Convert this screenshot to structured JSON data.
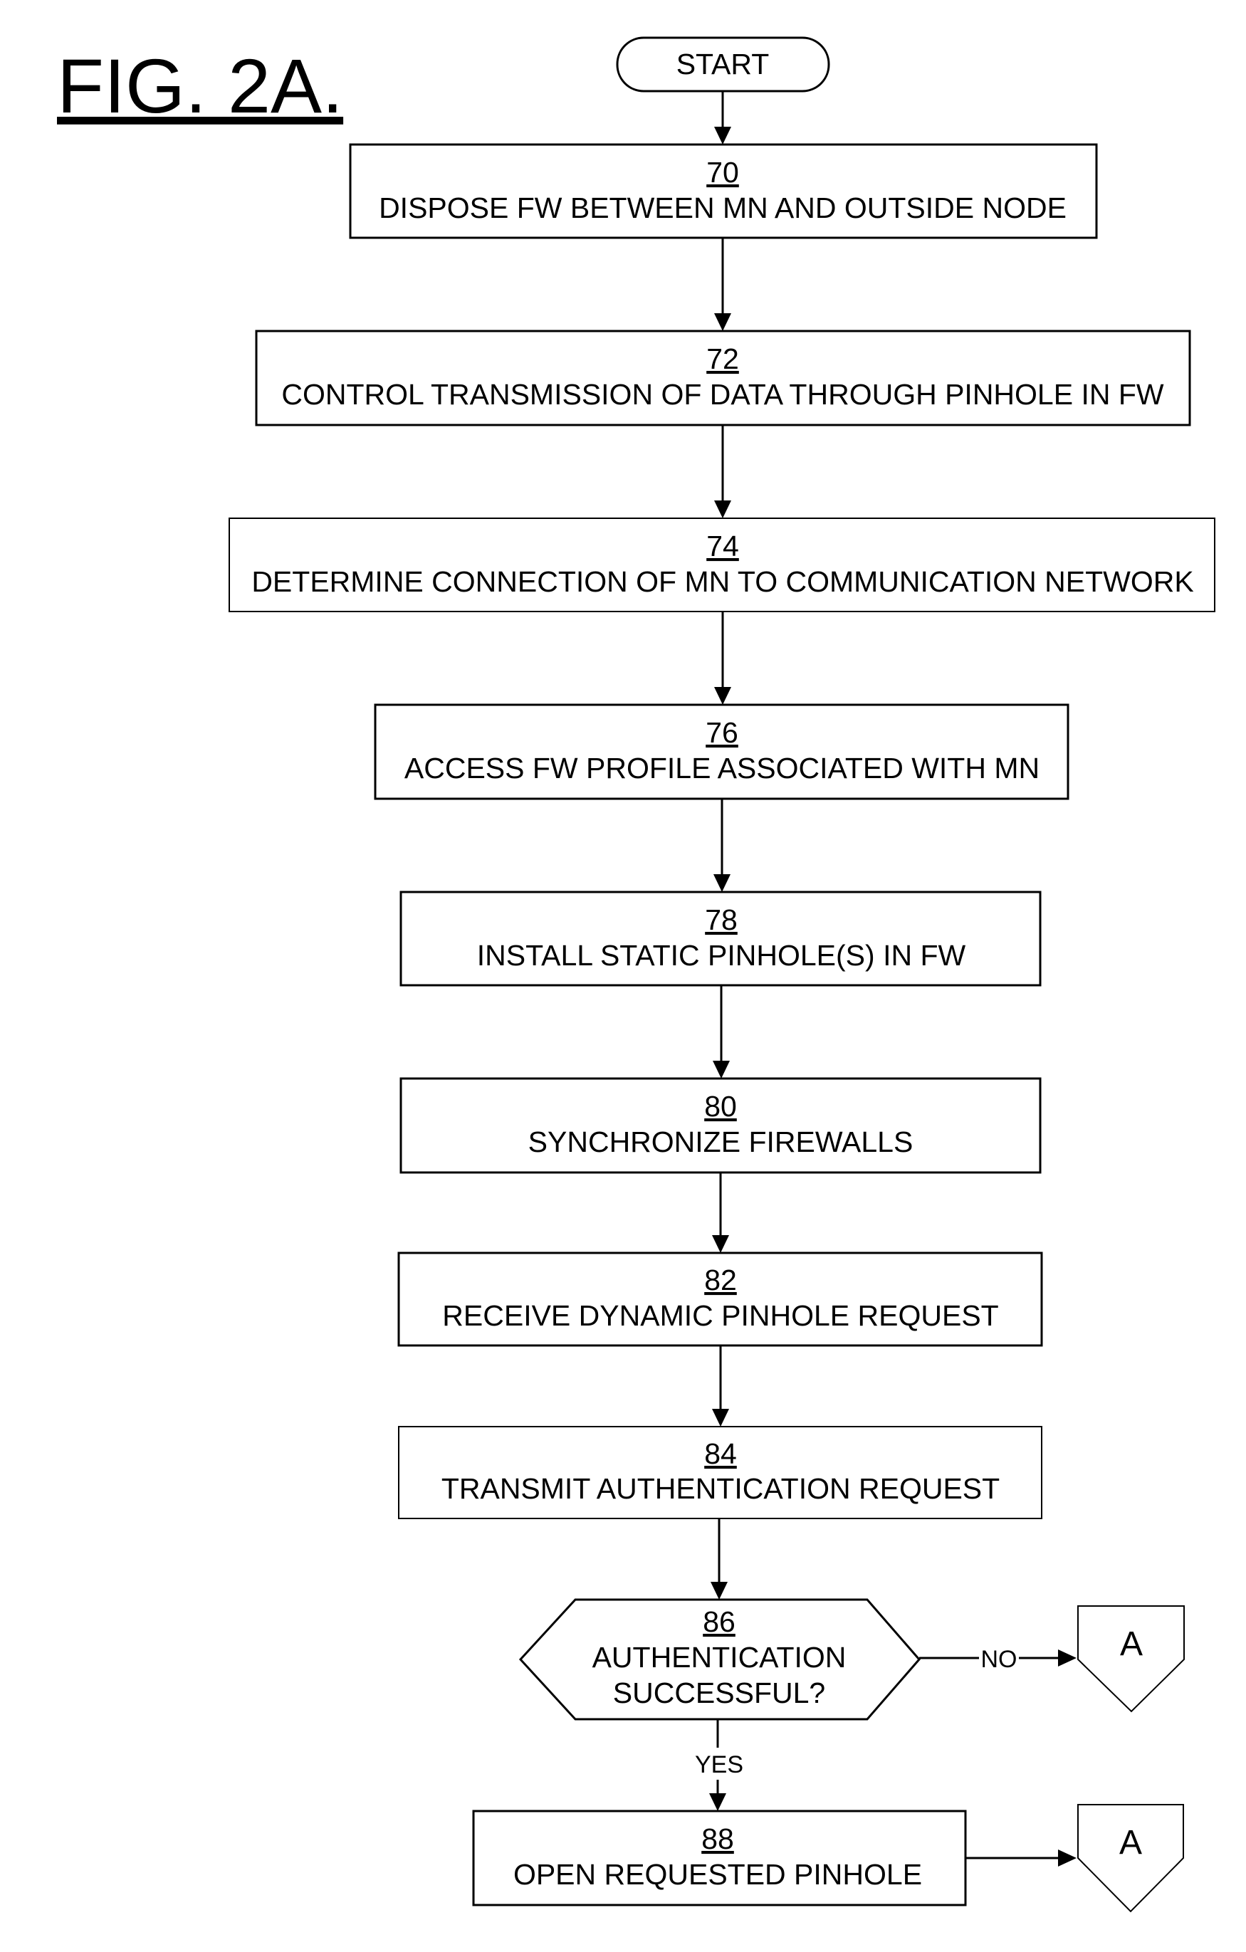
{
  "figure": {
    "title": "FIG. 2A."
  },
  "start": {
    "label": "START"
  },
  "steps": [
    {
      "ref": "70",
      "text": "DISPOSE FW BETWEEN MN AND OUTSIDE NODE"
    },
    {
      "ref": "72",
      "text": "CONTROL TRANSMISSION OF DATA THROUGH PINHOLE IN FW"
    },
    {
      "ref": "74",
      "text": "DETERMINE CONNECTION OF MN TO COMMUNICATION NETWORK"
    },
    {
      "ref": "76",
      "text": "ACCESS FW PROFILE ASSOCIATED WITH MN"
    },
    {
      "ref": "78",
      "text": "INSTALL STATIC PINHOLE(S) IN FW"
    },
    {
      "ref": "80",
      "text": "SYNCHRONIZE FIREWALLS"
    },
    {
      "ref": "82",
      "text": "RECEIVE DYNAMIC PINHOLE REQUEST"
    },
    {
      "ref": "84",
      "text": "TRANSMIT AUTHENTICATION REQUEST"
    }
  ],
  "decision": {
    "ref": "86",
    "line1": "AUTHENTICATION",
    "line2": "SUCCESSFUL?",
    "no_label": "NO",
    "yes_label": "YES"
  },
  "final_step": {
    "ref": "88",
    "text": "OPEN REQUESTED PINHOLE"
  },
  "connectors": [
    {
      "label": "A"
    },
    {
      "label": "A"
    }
  ]
}
